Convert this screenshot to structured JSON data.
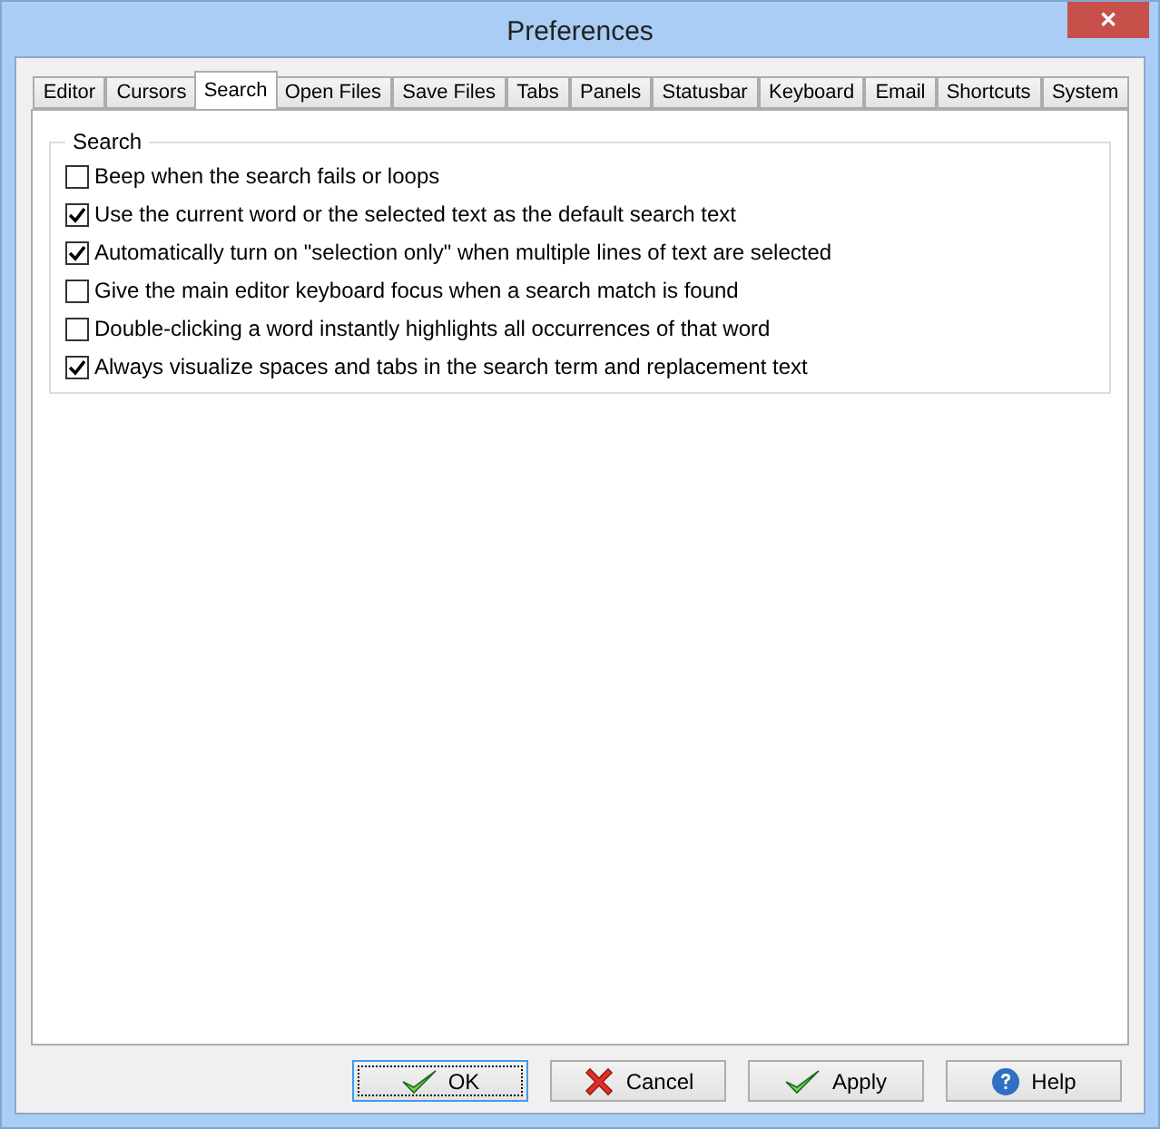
{
  "window": {
    "title": "Preferences",
    "close": "✕"
  },
  "tabs": [
    {
      "label": "Editor",
      "selected": false
    },
    {
      "label": "Cursors",
      "selected": false
    },
    {
      "label": "Search",
      "selected": true
    },
    {
      "label": "Open Files",
      "selected": false
    },
    {
      "label": "Save Files",
      "selected": false
    },
    {
      "label": "Tabs",
      "selected": false
    },
    {
      "label": "Panels",
      "selected": false
    },
    {
      "label": "Statusbar",
      "selected": false
    },
    {
      "label": "Keyboard",
      "selected": false
    },
    {
      "label": "Email",
      "selected": false
    },
    {
      "label": "Shortcuts",
      "selected": false
    },
    {
      "label": "System",
      "selected": false
    }
  ],
  "group": {
    "title": "Search",
    "options": [
      {
        "label": "Beep when the search fails or loops",
        "checked": false
      },
      {
        "label": "Use the current word or the selected text as the default search text",
        "checked": true
      },
      {
        "label": "Automatically turn on \"selection only\" when multiple lines of text are selected",
        "checked": true
      },
      {
        "label": "Give the main editor keyboard focus when a search match is found",
        "checked": false
      },
      {
        "label": "Double-clicking a word instantly highlights all occurrences of that word",
        "checked": false
      },
      {
        "label": "Always visualize spaces and tabs in the search term and replacement text",
        "checked": true
      }
    ]
  },
  "buttons": [
    {
      "label": "OK",
      "kind": "ok",
      "focused": true
    },
    {
      "label": "Cancel",
      "kind": "cancel",
      "focused": false
    },
    {
      "label": "Apply",
      "kind": "apply",
      "focused": false
    },
    {
      "label": "Help",
      "kind": "help",
      "focused": false
    }
  ]
}
